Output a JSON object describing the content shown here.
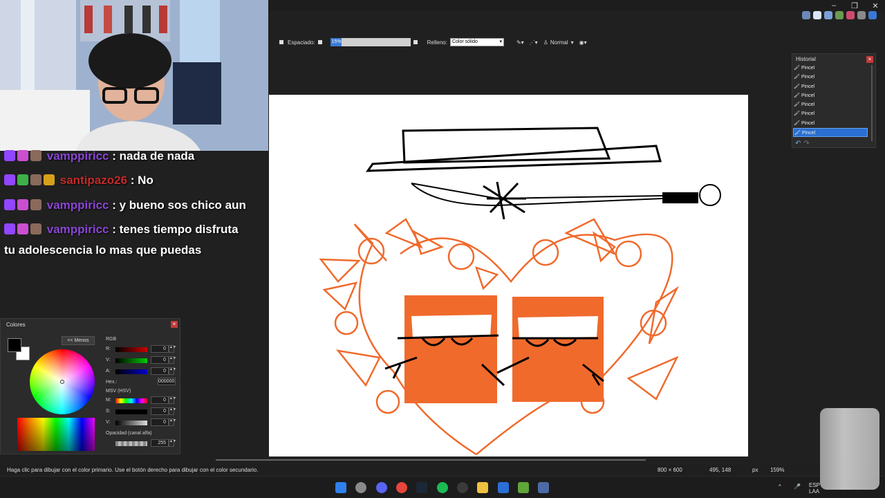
{
  "options_bar": {
    "spacing_label": "Espaciado:",
    "spacing_value": "15%",
    "fill_label": "Relleno:",
    "fill_value": "Color sólido",
    "blend_mode": "Normal"
  },
  "chat": {
    "messages": [
      {
        "user": "vamppiricc",
        "text": ": nada de nada"
      },
      {
        "user": "santipazo26",
        "text": ": No"
      },
      {
        "user": "vamppiricc",
        "text": ": y bueno sos chico aun"
      },
      {
        "user": "vamppiricc",
        "text": ": tenes tiempo disfruta"
      },
      {
        "user": "",
        "text": "tu adolescencia lo mas que puedas"
      }
    ]
  },
  "history": {
    "title": "Historial",
    "items": [
      "Pincel",
      "Pincel",
      "Pincel",
      "Pincel",
      "Pincel",
      "Pincel",
      "Pincel",
      "Pincel"
    ],
    "selected_index": 7
  },
  "colors_panel": {
    "title": "Colores",
    "less_button": "<< Menos",
    "rgb_label": "RGB",
    "r_label": "R:",
    "g_label": "V:",
    "b_label": "A:",
    "r_value": "0",
    "g_value": "0",
    "b_value": "0",
    "hex_label": "Hex.:",
    "hex_value": "000000",
    "hsv_label": "MSV (HSV)",
    "h_label": "M:",
    "s_label": "S:",
    "v_label": "V:",
    "h_value": "0",
    "s_value": "0",
    "v_value": "0",
    "alpha_label": "Opacidad (canal alfa)",
    "alpha_value": "255",
    "primary_color": "#000000",
    "secondary_color": "#ffffff"
  },
  "status": {
    "hint": "Haga clic para dibujar con el color primario. Use el botón derecho para dibujar con el color secundario.",
    "image_size": "800 × 600",
    "cursor_pos": "495, 148",
    "unit": "px",
    "zoom": "159%"
  },
  "taskbar": {
    "lang_top": "ESP",
    "lang_bottom": "LAA"
  },
  "colors": {
    "accent": "#2a6fd1",
    "drawing_orange": "#f06a2c",
    "chat_purple": "#8b45d6",
    "chat_red": "#c42a2a"
  }
}
